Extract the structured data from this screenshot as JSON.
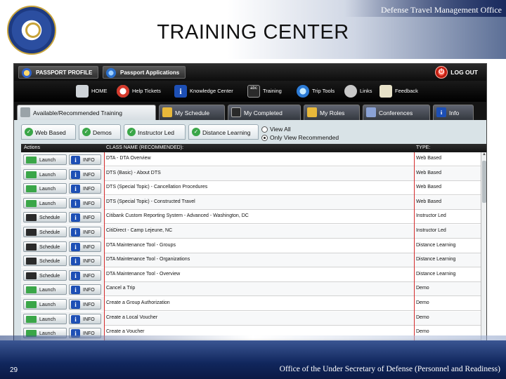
{
  "slide": {
    "header": "Defense Travel Management Office",
    "title": "TRAINING CENTER",
    "page_number": "29",
    "footer": "Office of the Under Secretary of Defense (Personnel and Readiness)"
  },
  "topbar": {
    "passport_profile": "PASSPORT PROFILE",
    "passport_applications": "Passport Applications",
    "logout": "LOG OUT"
  },
  "nav": {
    "home": "HOME",
    "help_tickets": "Help Tickets",
    "knowledge_center": "Knowledge Center",
    "training": "Training",
    "trip_tools": "Trip Tools",
    "links": "Links",
    "feedback": "Feedback",
    "training_icon_text": "abc"
  },
  "tabs": {
    "available_training": "Available/Recommended Training",
    "my_schedule": "My Schedule",
    "my_completed": "My Completed",
    "my_roles": "My Roles",
    "conferences": "Conferences",
    "info": "Info"
  },
  "subtabs": {
    "web_based": "Web Based",
    "demos": "Demos",
    "instructor_led": "Instructor Led",
    "distance_learning": "Distance Learning"
  },
  "view_options": {
    "view_all": "View All",
    "only_recommended": "Only View Recommended",
    "selected": "only_recommended"
  },
  "grid": {
    "headers": {
      "actions": "Actions",
      "class_name": "CLASS NAME (RECOMMENDED):",
      "type": "TYPE:"
    },
    "info_label": "INFO",
    "rows": [
      {
        "action": "Launch",
        "name": "DTA - DTA Overview",
        "type": "Web Based"
      },
      {
        "action": "Launch",
        "name": "DTS (Basic) - About DTS",
        "type": "Web Based"
      },
      {
        "action": "Launch",
        "name": "DTS (Special Topic) - Cancellation Procedures",
        "type": "Web Based"
      },
      {
        "action": "Launch",
        "name": "DTS (Special Topic) - Constructed Travel",
        "type": "Web Based"
      },
      {
        "action": "Schedule",
        "name": "Citibank Custom Reporting System - Advanced - Washington, DC",
        "type": "Instructor Led"
      },
      {
        "action": "Schedule",
        "name": "CitiDirect - Camp Lejeune, NC",
        "type": "Instructor Led"
      },
      {
        "action": "Schedule",
        "name": "DTA Maintenance Tool - Groups",
        "type": "Distance Learning"
      },
      {
        "action": "Schedule",
        "name": "DTA Maintenance Tool - Organizations",
        "type": "Distance Learning"
      },
      {
        "action": "Schedule",
        "name": "DTA Maintenance Tool - Overview",
        "type": "Distance Learning"
      },
      {
        "action": "Launch",
        "name": "Cancel a Trip",
        "type": "Demo"
      },
      {
        "action": "Launch",
        "name": "Create a Group Authorization",
        "type": "Demo"
      },
      {
        "action": "Launch",
        "name": "Create a Local Voucher",
        "type": "Demo"
      },
      {
        "action": "Launch",
        "name": "Create a Voucher",
        "type": "Demo"
      }
    ]
  },
  "colors": {
    "brand_dark": "#10265c",
    "type_divider": "#d52b2b",
    "check_green": "#3aa648",
    "info_blue": "#1d4fb5"
  }
}
